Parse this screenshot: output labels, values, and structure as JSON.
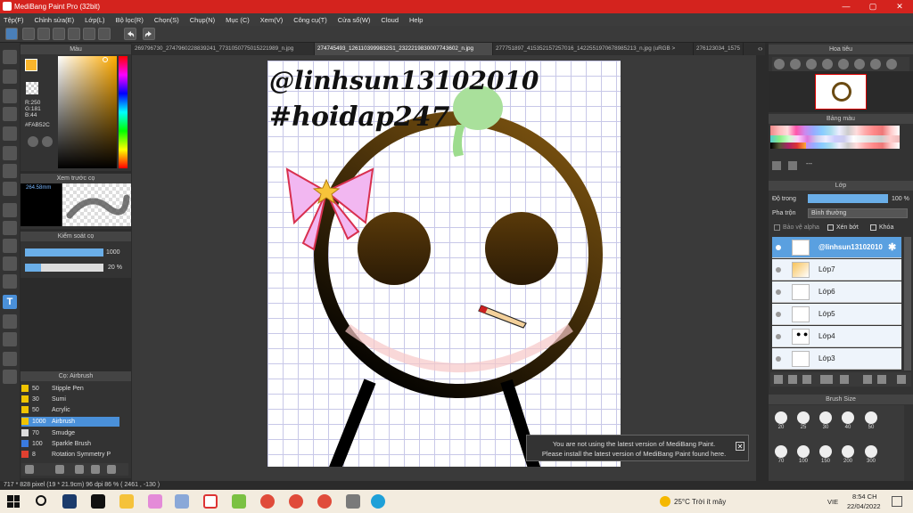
{
  "window": {
    "title": "MediBang Paint Pro (32bit)"
  },
  "menu": [
    "Tệp(F)",
    "Chỉnh sửa(E)",
    "Lớp(L)",
    "Bộ lọc(R)",
    "Chọn(S)",
    "Chụp(N)",
    "Mục (C)",
    "Xem(V)",
    "Công cụ(T)",
    "Cửa sổ(W)",
    "Cloud",
    "Help"
  ],
  "tabs": [
    "269796730_2747960228839241_7731050775015221989_n.jpg",
    "274745493_1261103999832S1_2322219830007743602_n.jpg",
    "277751897_415352157257016_1422551970678985213_n.jpg (uRGB >",
    "276123034_1575"
  ],
  "color_panel": {
    "title": "Màu",
    "r": "R:250",
    "g": "G:181",
    "b": "B:44",
    "hex": "#FAB52C",
    "fg_color": "#FAB52C"
  },
  "brush_preview": {
    "title": "Xem trước cọ",
    "size": "264.58mm"
  },
  "brush_control": {
    "title": "Kiểm soát cọ",
    "size_value": "1000",
    "opacity_value": "20 %"
  },
  "brush_list": {
    "title": "Cọ: Airbrush",
    "items": [
      {
        "num": "50",
        "name": "Stipple Pen",
        "color": "#f0c400"
      },
      {
        "num": "30",
        "name": "Sumi",
        "color": "#f0c400"
      },
      {
        "num": "50",
        "name": "Acrylic",
        "color": "#f0c400"
      },
      {
        "num": "1000",
        "name": "Airbrush",
        "color": "#f0c400"
      },
      {
        "num": "70",
        "name": "Smudge",
        "color": "#dddddd"
      },
      {
        "num": "100",
        "name": "Sparkle Brush",
        "color": "#3a7be0"
      },
      {
        "num": "8",
        "name": "Rotation Symmetry P",
        "color": "#e04030"
      }
    ]
  },
  "canvas": {
    "text1": "@linhsun13102010",
    "text2": "#hoidap247"
  },
  "notification": {
    "line1": "You are not using the latest version of MediBang Paint.",
    "line2": "Please install the latest version of MediBang Paint found here."
  },
  "navigator": {
    "title": "Hoa tiêu"
  },
  "palette": {
    "title": "Bảng màu",
    "dash": "---"
  },
  "layer_panel": {
    "title": "Lớp",
    "opacity_label": "Độ trong",
    "opacity_value": "100 %",
    "blend_label": "Pha trộn",
    "blend_value": "Bình thường",
    "protect_alpha": "Bảo vệ alpha",
    "clip": "Xén bớt",
    "lock": "Khóa",
    "layers": [
      "@linhsun13102010",
      "Lớp7",
      "Lớp6",
      "Lớp5",
      "Lớp4",
      "Lớp3"
    ]
  },
  "brush_size": {
    "title": "Brush Size",
    "sizes": [
      "20",
      "25",
      "30",
      "40",
      "50",
      "70",
      "100",
      "150",
      "200",
      "300"
    ]
  },
  "status": "717 * 828 pixel  (19 * 21.9cm)  96 dpi  86 %  ( 2461 , -130 )",
  "taskbar": {
    "weather": "25°C  Trời ít mây",
    "lang": "VIE",
    "time": "8:54 CH",
    "date": "22/04/2022"
  }
}
